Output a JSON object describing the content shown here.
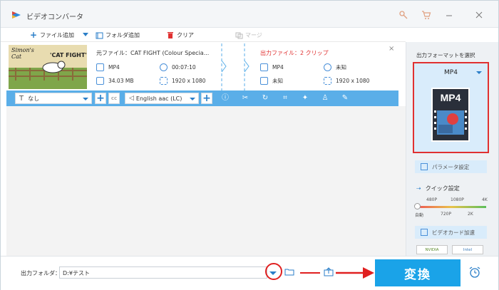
{
  "app": {
    "title": "ビデオコンバータ"
  },
  "toolbar": {
    "add_file": "ファイル追加",
    "add_folder": "フォルダ追加",
    "clear": "クリア",
    "merge": "マージ"
  },
  "file": {
    "thumb_title_left": "Simon's Cat",
    "thumb_title_right": "'CAT FIGHT'",
    "source_label": "元ファイル：",
    "source_name": "CAT FIGHT (Colour Specia...",
    "source_format": "MP4",
    "source_duration": "00:07:10",
    "source_size": "34.03 MB",
    "source_resolution": "1920 x 1080",
    "output_label": "出力ファイル：",
    "output_clips": "2 クリップ",
    "output_format": "MP4",
    "output_duration": "未知",
    "output_size": "未知",
    "output_resolution": "1920 x 1080",
    "close": "×"
  },
  "editbar": {
    "subtitle": "なし",
    "audio": "English aac (LC)"
  },
  "right_panel": {
    "title": "出力フォーマットを選択",
    "format": "MP4",
    "format_icon_text": "MP4",
    "param_settings": "パラメータ設定",
    "quick_settings": "クイック設定",
    "quality_top": [
      "480P",
      "1080P",
      "4K"
    ],
    "quality_bottom": [
      "自動",
      "720P",
      "2K"
    ],
    "gpu_accel": "ビデオカード加速",
    "nvidia": "NVIDIA",
    "intel": "Intel"
  },
  "bottom": {
    "output_folder_label": "出力フォルダ：",
    "output_folder_value": "D:¥テスト",
    "convert": "変換"
  },
  "colors": {
    "accent": "#1aa3e8",
    "editbar": "#5aaee8",
    "highlight": "#e02020"
  }
}
